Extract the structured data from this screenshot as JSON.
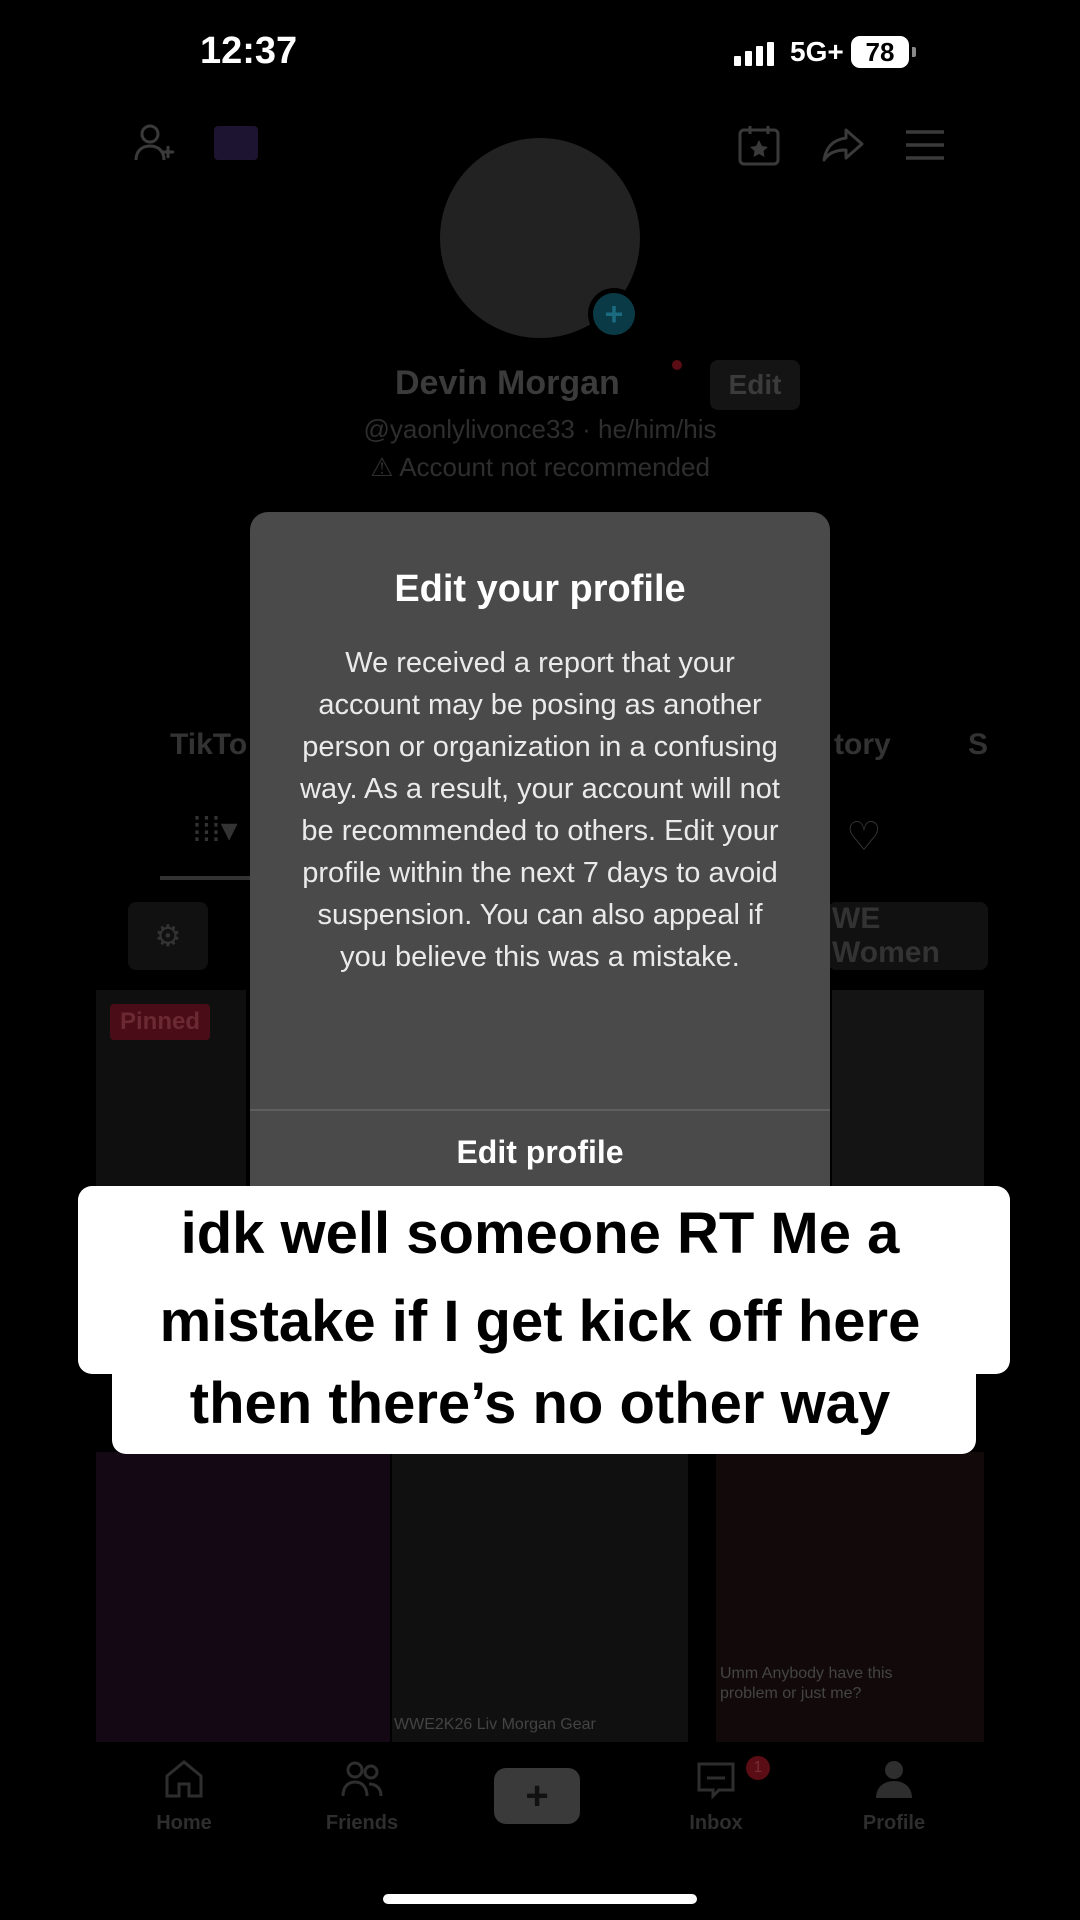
{
  "status_bar": {
    "time": "12:37",
    "network": "5G+",
    "battery": "78"
  },
  "profile": {
    "display_name": "Devin Morgan",
    "edit_label": "Edit",
    "handle": "@yaonlylivonce33 · he/him/his",
    "warning": "Account not recommended",
    "tabs_visible": [
      "TikTo",
      "tory",
      "S"
    ],
    "chip_right": "WE Women",
    "pinned_label": "Pinned",
    "thumb_captions": [
      "WWE2K26 Liv Morgan Gear",
      "Umm Anybody have this problem or just me?"
    ]
  },
  "dialog": {
    "title": "Edit your profile",
    "body": "We received a report that your account may be posing as another person or organization in a confusing way. As a result, your account will not be recommended to others. Edit your profile within the next 7 days to avoid suspension. You can also appeal if you believe this was a mistake.",
    "button": "Edit profile"
  },
  "caption": {
    "lines": [
      "idk well someone RT Me a",
      "mistake if I get kick off here",
      "then there’s no other way"
    ]
  },
  "nav": {
    "items": [
      {
        "label": "Home",
        "icon": "home-icon"
      },
      {
        "label": "Friends",
        "icon": "friends-icon"
      },
      {
        "label": "Inbox",
        "icon": "inbox-icon"
      },
      {
        "label": "Profile",
        "icon": "profile-icon"
      }
    ],
    "create_label": "+",
    "inbox_badge": "1"
  },
  "colors": {
    "background": "#000000",
    "dialog": "#4a4a4a",
    "caption_bg": "#ffffff"
  }
}
